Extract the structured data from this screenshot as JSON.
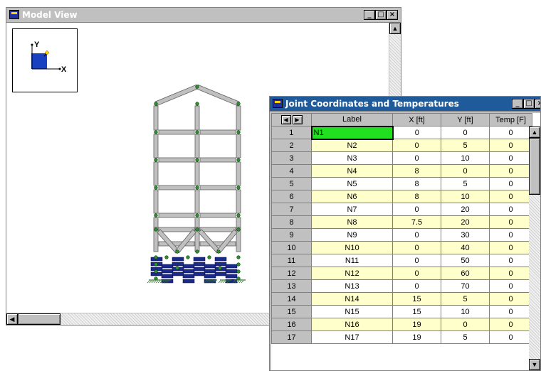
{
  "model_window": {
    "title": "Model View",
    "buttons": {
      "minimize": "_",
      "maximize": "□",
      "close": "×"
    },
    "axis": {
      "y_label": "Y",
      "x_label": "X"
    }
  },
  "joint_window": {
    "title": "Joint Coordinates and Temperatures",
    "buttons": {
      "minimize": "_",
      "maximize": "□",
      "close": "×"
    },
    "columns": [
      "Label",
      "X [ft]",
      "Y [ft]",
      "Temp [F]"
    ],
    "rows": [
      {
        "num": "1",
        "label": "N1",
        "x": "0",
        "y": "0",
        "temp": "0"
      },
      {
        "num": "2",
        "label": "N2",
        "x": "0",
        "y": "5",
        "temp": "0"
      },
      {
        "num": "3",
        "label": "N3",
        "x": "0",
        "y": "10",
        "temp": "0"
      },
      {
        "num": "4",
        "label": "N4",
        "x": "8",
        "y": "0",
        "temp": "0"
      },
      {
        "num": "5",
        "label": "N5",
        "x": "8",
        "y": "5",
        "temp": "0"
      },
      {
        "num": "6",
        "label": "N6",
        "x": "8",
        "y": "10",
        "temp": "0"
      },
      {
        "num": "7",
        "label": "N7",
        "x": "0",
        "y": "20",
        "temp": "0"
      },
      {
        "num": "8",
        "label": "N8",
        "x": "7.5",
        "y": "20",
        "temp": "0"
      },
      {
        "num": "9",
        "label": "N9",
        "x": "0",
        "y": "30",
        "temp": "0"
      },
      {
        "num": "10",
        "label": "N10",
        "x": "0",
        "y": "40",
        "temp": "0"
      },
      {
        "num": "11",
        "label": "N11",
        "x": "0",
        "y": "50",
        "temp": "0"
      },
      {
        "num": "12",
        "label": "N12",
        "x": "0",
        "y": "60",
        "temp": "0"
      },
      {
        "num": "13",
        "label": "N13",
        "x": "0",
        "y": "70",
        "temp": "0"
      },
      {
        "num": "14",
        "label": "N14",
        "x": "15",
        "y": "5",
        "temp": "0"
      },
      {
        "num": "15",
        "label": "N15",
        "x": "15",
        "y": "10",
        "temp": "0"
      },
      {
        "num": "16",
        "label": "N16",
        "x": "19",
        "y": "0",
        "temp": "0"
      },
      {
        "num": "17",
        "label": "N17",
        "x": "19",
        "y": "5",
        "temp": "0"
      }
    ]
  },
  "colors": {
    "member": "#c0c0c0",
    "node": "#2f8f2f",
    "plate": "#1a2a8a",
    "selected_cell": "#20e020",
    "alt_row": "#ffffcc"
  }
}
